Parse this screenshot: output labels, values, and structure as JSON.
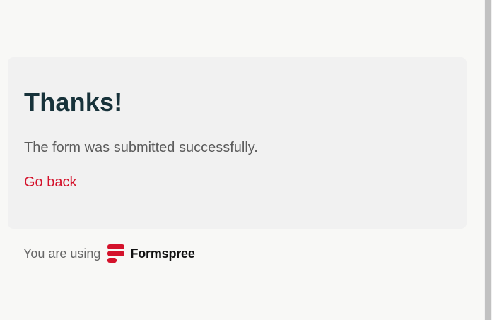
{
  "card": {
    "title": "Thanks!",
    "message": "The form was submitted successfully.",
    "back_link": "Go back"
  },
  "footer": {
    "text": "You are using",
    "brand_name": "Formspree",
    "brand_icon": "formspree-logo-icon"
  },
  "colors": {
    "page_background": "#f8f8f6",
    "card_background": "#f1f1f1",
    "title": "#17323a",
    "link": "#d4122b",
    "brand_red": "#d4122b"
  }
}
